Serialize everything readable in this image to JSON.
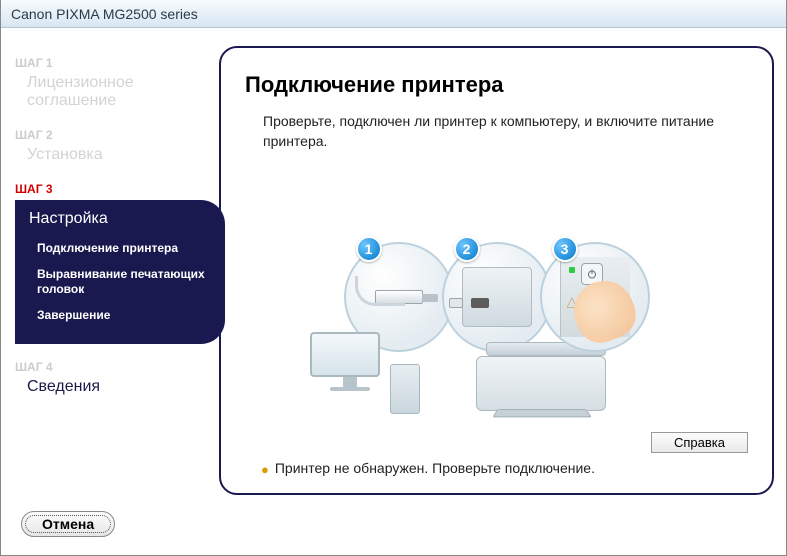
{
  "window": {
    "title": "Canon PIXMA MG2500 series"
  },
  "sidebar": {
    "steps": [
      {
        "label": "ШАГ 1",
        "title": "Лицензионное соглашение"
      },
      {
        "label": "ШАГ 2",
        "title": "Установка"
      },
      {
        "label": "ШАГ 3",
        "title": "Настройка"
      },
      {
        "label": "ШАГ 4",
        "title": "Сведения"
      }
    ],
    "substeps": [
      "Подключение принтера",
      "Выравнивание печатающих головок",
      "Завершение"
    ]
  },
  "content": {
    "heading": "Подключение принтера",
    "instruction": "Проверьте, подключен ли принтер к компьютеру, и включите питание принтера.",
    "bubbles": [
      "1",
      "2",
      "3"
    ],
    "help": "Справка",
    "status": "Принтер не обнаружен. Проверьте подключение."
  },
  "footer": {
    "cancel": "Отмена"
  }
}
